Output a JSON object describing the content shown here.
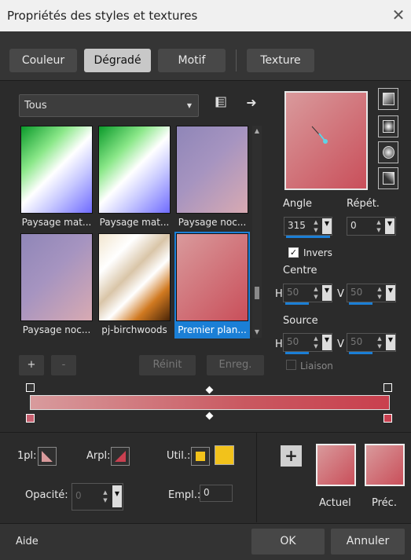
{
  "window": {
    "title": "Propriétés des styles et textures",
    "close": "✕"
  },
  "tabs": [
    {
      "label": "Couleur"
    },
    {
      "label": "Dégradé"
    },
    {
      "label": "Motif"
    },
    {
      "label": "Texture"
    }
  ],
  "active_tab": "Dégradé",
  "category": {
    "value": "Tous"
  },
  "gradients": [
    {
      "label": "Paysage mat...",
      "bg": "linear-gradient(135deg,#0a9a2a 0%,#8ce88a 30%,#ffffff 50%,#c7c8ff 70%,#6f6bff 100%)"
    },
    {
      "label": "Paysage mat...",
      "bg": "linear-gradient(135deg,#0a9a2a 0%,#8ce88a 30%,#ffffff 50%,#c7c8ff 70%,#6f6bff 100%)"
    },
    {
      "label": "Paysage noc...",
      "bg": "linear-gradient(135deg,#8f86b8 0%,#a694c0 45%,#d8aab2 100%)"
    },
    {
      "label": "Paysage noc...",
      "bg": "linear-gradient(135deg,#8f86b8 0%,#a694c0 45%,#d8aab2 100%)"
    },
    {
      "label": "pj-birchwoods",
      "bg": "linear-gradient(135deg,#f2e6cf 0%,#ffffff 25%,#d9c5a8 45%,#ffffff 60%,#d07920 78%,#4a2508 100%)"
    },
    {
      "label": "Premier plan...",
      "bg": "linear-gradient(135deg,#d99a9c 0%,#c94f5a 100%)"
    }
  ],
  "list_buttons": {
    "add": "+",
    "remove": "-",
    "reset": "Réinit",
    "save": "Enreg."
  },
  "settings": {
    "angle_label": "Angle",
    "angle": "315",
    "repeat_label": "Répét.",
    "repeat": "0",
    "invert_label": "Invers",
    "invert_checked": true,
    "center_label": "Centre",
    "center_h": "50",
    "center_v": "50",
    "source_label": "Source",
    "source_h": "50",
    "source_v": "50",
    "link_label": "Liaison",
    "h": "H",
    "v": "V"
  },
  "colors": {
    "fg_label": "1pl:",
    "bg_label": "Arpl:",
    "user_label": "Util.:",
    "user_color": "#f2c21b",
    "opacity_label": "Opacité:",
    "opacity": "0",
    "location_label": "Empl.:",
    "location": "0",
    "add": "+",
    "current_label": "Actuel",
    "previous_label": "Préc."
  },
  "footer": {
    "help": "Aide",
    "ok": "OK",
    "cancel": "Annuler"
  }
}
